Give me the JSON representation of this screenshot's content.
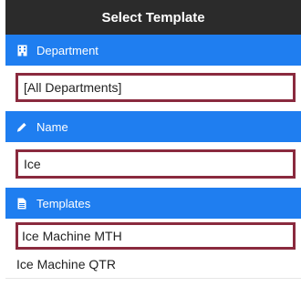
{
  "window": {
    "title": "Select Template"
  },
  "department": {
    "header_label": "Department",
    "header_icon": "building-icon",
    "value": "[All Departments]"
  },
  "name": {
    "header_label": "Name",
    "header_icon": "pencil-icon",
    "value": "Ice"
  },
  "templates": {
    "header_label": "Templates",
    "header_icon": "document-icon",
    "items": [
      {
        "label": "Ice Machine MTH",
        "selected": true
      },
      {
        "label": "Ice Machine QTR",
        "selected": false
      }
    ]
  },
  "colors": {
    "titlebar": "#2b2b2b",
    "section_header": "#1f7ef0",
    "highlight_border": "#8a2a3e"
  }
}
